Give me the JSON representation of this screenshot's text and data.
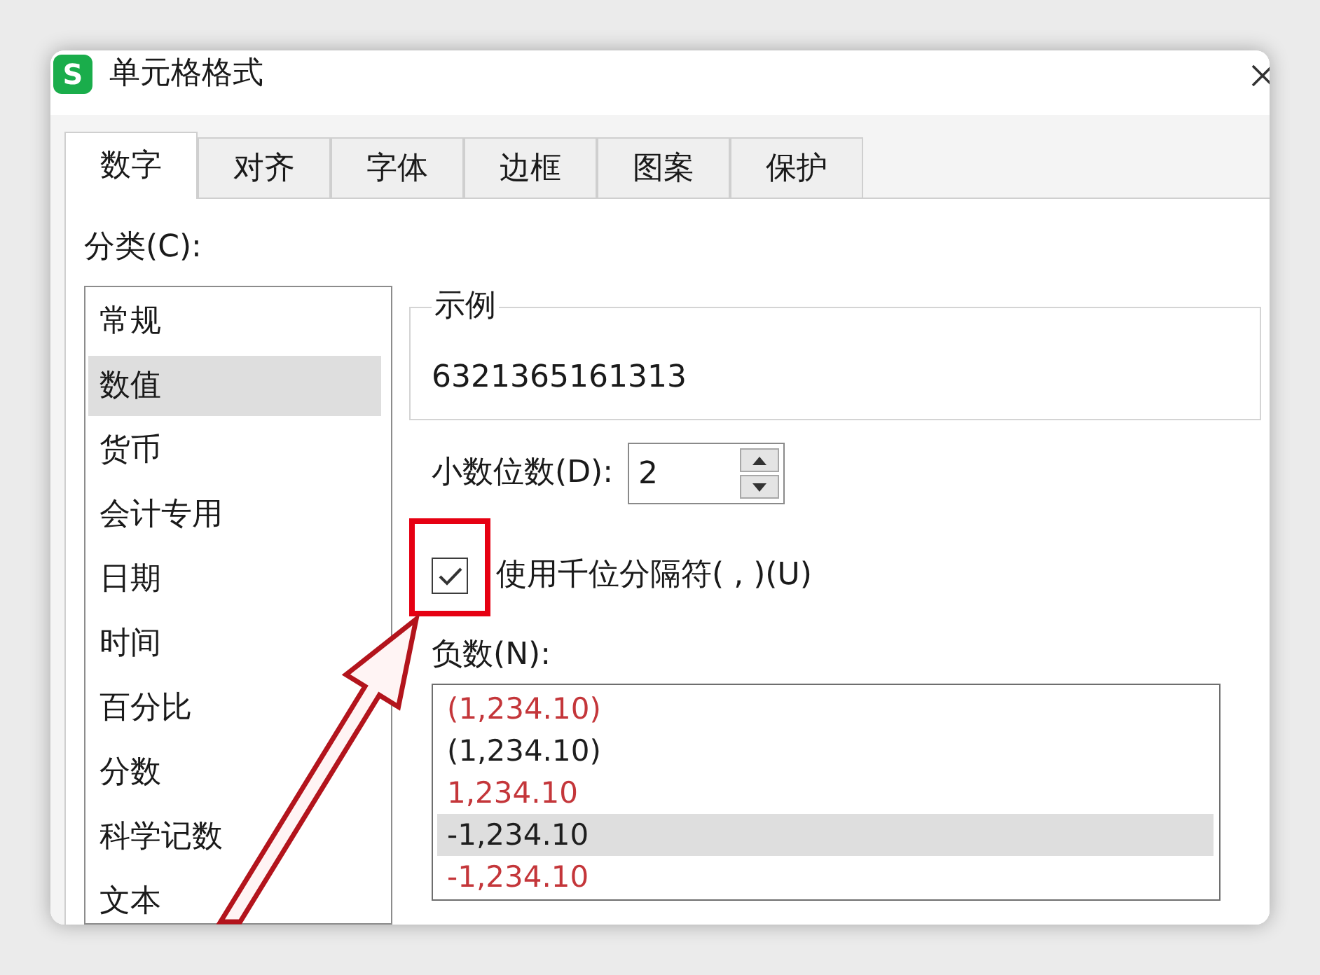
{
  "window": {
    "logo": "S",
    "title": "单元格格式"
  },
  "tabs": [
    {
      "label": "数字",
      "selected": true
    },
    {
      "label": "对齐",
      "selected": false
    },
    {
      "label": "字体",
      "selected": false
    },
    {
      "label": "边框",
      "selected": false
    },
    {
      "label": "图案",
      "selected": false
    },
    {
      "label": "保护",
      "selected": false
    }
  ],
  "category": {
    "label": "分类(C):",
    "items": [
      {
        "label": "常规",
        "selected": false
      },
      {
        "label": "数值",
        "selected": true
      },
      {
        "label": "货币",
        "selected": false
      },
      {
        "label": "会计专用",
        "selected": false
      },
      {
        "label": "日期",
        "selected": false
      },
      {
        "label": "时间",
        "selected": false
      },
      {
        "label": "百分比",
        "selected": false
      },
      {
        "label": "分数",
        "selected": false
      },
      {
        "label": "科学记数",
        "selected": false
      },
      {
        "label": "文本",
        "selected": false
      }
    ]
  },
  "sample": {
    "legend": "示例",
    "value": "6321365161313"
  },
  "decimal_places": {
    "label": "小数位数(D):",
    "value": "2"
  },
  "thousands_separator": {
    "label": "使用千位分隔符( , )(U)",
    "checked": true
  },
  "negative_numbers": {
    "label": "负数(N):",
    "items": [
      {
        "text": "(1,234.10)",
        "color": "#c4363a",
        "selected": false
      },
      {
        "text": "(1,234.10)",
        "color": "#1e1e1e",
        "selected": false
      },
      {
        "text": "1,234.10",
        "color": "#c4363a",
        "selected": false
      },
      {
        "text": "-1,234.10",
        "color": "#1e1e1e",
        "selected": true
      },
      {
        "text": "-1,234.10",
        "color": "#c4363a",
        "selected": false
      }
    ]
  }
}
